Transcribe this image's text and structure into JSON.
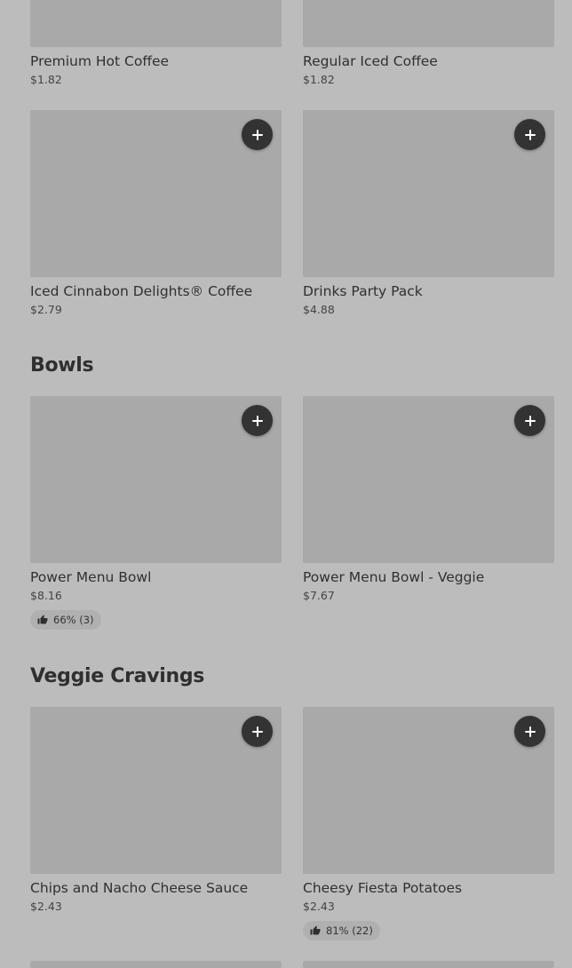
{
  "top_items": [
    {
      "name": "Premium Hot Coffee",
      "price": "$1.82"
    },
    {
      "name": "Regular Iced Coffee",
      "price": "$1.82"
    }
  ],
  "coffee_items": [
    {
      "name": "Iced Cinnabon Delights® Coffee",
      "price": "$2.79"
    },
    {
      "name": "Drinks Party Pack",
      "price": "$4.88"
    }
  ],
  "bowls": {
    "title": "Bowls",
    "items": [
      {
        "name": "Power Menu Bowl",
        "price": "$8.16",
        "rating": "66% (3)"
      },
      {
        "name": "Power Menu Bowl - Veggie",
        "price": "$7.67"
      }
    ]
  },
  "veggie_cravings": {
    "title": "Veggie Cravings",
    "items": [
      {
        "name": "Chips and Nacho Cheese Sauce",
        "price": "$2.43"
      },
      {
        "name": "Cheesy Fiesta Potatoes",
        "price": "$2.43",
        "rating": "81% (22)"
      }
    ]
  },
  "icons": {
    "add": "plus-icon",
    "rating": "thumbs-up-icon"
  },
  "colors": {
    "background": "#bcbcbc",
    "image_placeholder": "#a9a9a9",
    "add_button": "#333333"
  }
}
